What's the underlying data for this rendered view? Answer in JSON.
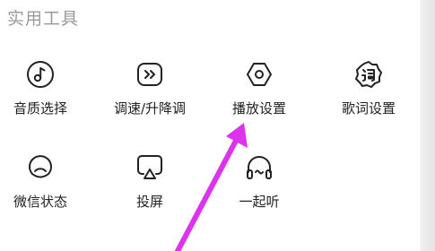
{
  "section": {
    "title": "实用工具"
  },
  "tools": [
    {
      "label": "音质选择",
      "icon": "music-note-circle-icon"
    },
    {
      "label": "调速/升降调",
      "icon": "speed-forward-icon"
    },
    {
      "label": "播放设置",
      "icon": "hexagon-settings-icon"
    },
    {
      "label": "歌词设置",
      "icon": "lyrics-badge-icon"
    },
    {
      "label": "微信状态",
      "icon": "status-ring-icon"
    },
    {
      "label": "投屏",
      "icon": "cast-screen-icon"
    },
    {
      "label": "一起听",
      "icon": "headphones-icon"
    }
  ],
  "colors": {
    "icon_stroke": "#222222",
    "arrow": "#dd33ee",
    "title": "#9a9a9a"
  }
}
